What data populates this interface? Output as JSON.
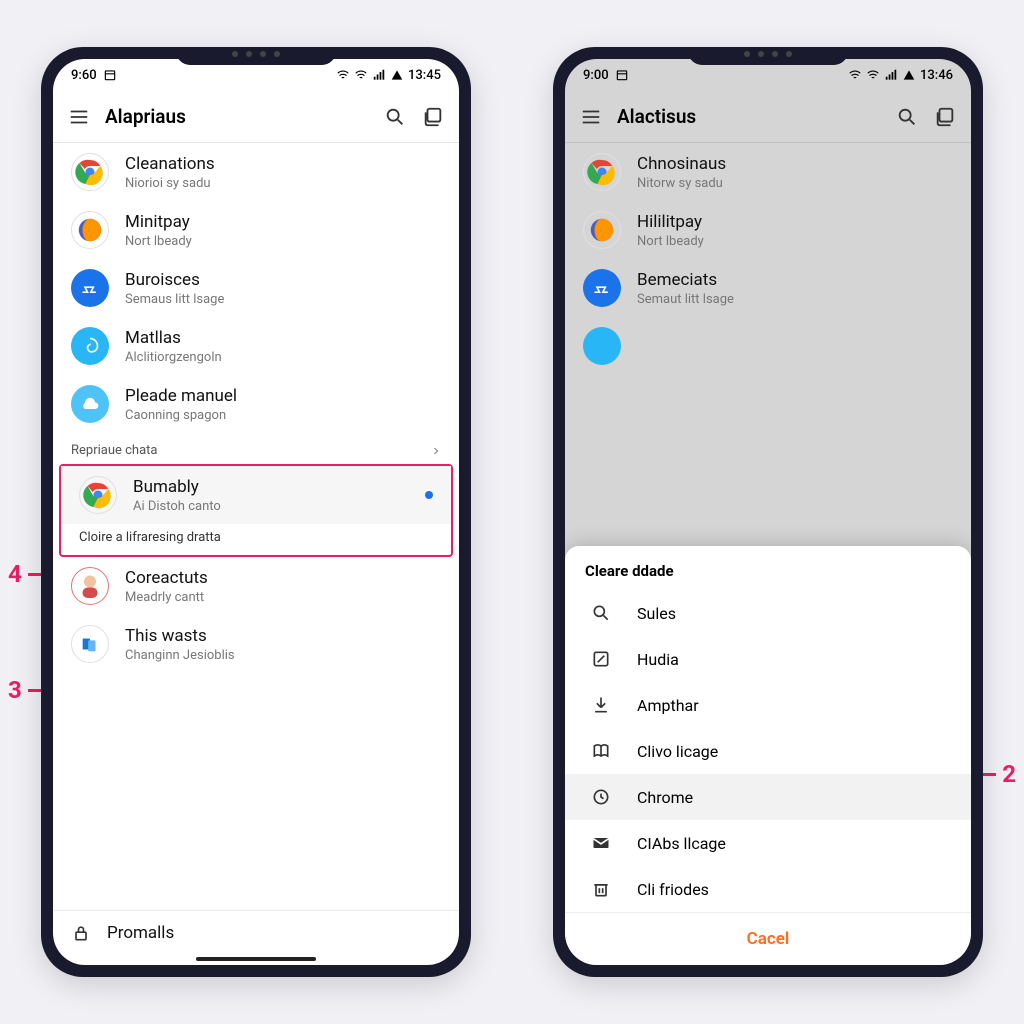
{
  "callouts": {
    "c2": "2",
    "c3": "3",
    "c4": "4"
  },
  "status": {
    "time_left": "9:60",
    "time_left_b": "9:00",
    "time_right": "13:45",
    "time_right_b": "13:46"
  },
  "phoneA": {
    "header_title": "Alapriaus",
    "items": [
      {
        "title": "Cleanations",
        "sub": "Niorioi sy sadu",
        "icon": "chrome"
      },
      {
        "title": "Minitpay",
        "sub": "Nort lbeady",
        "icon": "firefox"
      },
      {
        "title": "Buroisces",
        "sub": "Semaus litt lsage",
        "icon": "tool-blue"
      },
      {
        "title": "Matllas",
        "sub": "Alclitiorgzengoln",
        "icon": "swirl"
      },
      {
        "title": "Pleade manuel",
        "sub": "Caonning spagon",
        "icon": "cloud"
      }
    ],
    "section_header": "Repriaue chata",
    "highlighted": {
      "title": "Bumably",
      "sub": "Ai Distoh canto",
      "icon": "chrome",
      "caption": "Cloire a lifraresing dratta"
    },
    "more": [
      {
        "title": "Coreactuts",
        "sub": "Meadrly cantt",
        "icon": "person"
      },
      {
        "title": "This wasts",
        "sub": "Changinn Jesioblis",
        "icon": "files"
      }
    ],
    "bottom": "Promalls"
  },
  "phoneB": {
    "header_title": "Alactisus",
    "items": [
      {
        "title": "Chnosinaus",
        "sub": "Nitorw sy sadu",
        "icon": "chrome"
      },
      {
        "title": "Hililitpay",
        "sub": "Nort lbeady",
        "icon": "firefox"
      },
      {
        "title": "Bemeciats",
        "sub": "Semaut litt lsage",
        "icon": "tool-blue"
      }
    ],
    "sheet": {
      "title": "Cleare ddade",
      "rows": [
        {
          "icon": "search",
          "label": "Sules"
        },
        {
          "icon": "edit",
          "label": "Hudia"
        },
        {
          "icon": "download",
          "label": "Ampthar"
        },
        {
          "icon": "book",
          "label": "Clivo licage"
        },
        {
          "icon": "clock",
          "label": "Chrome",
          "selected": true
        },
        {
          "icon": "mail",
          "label": "CIAbs llcage"
        },
        {
          "icon": "trash",
          "label": "Cli friodes"
        }
      ],
      "footer": "Cacel"
    }
  }
}
